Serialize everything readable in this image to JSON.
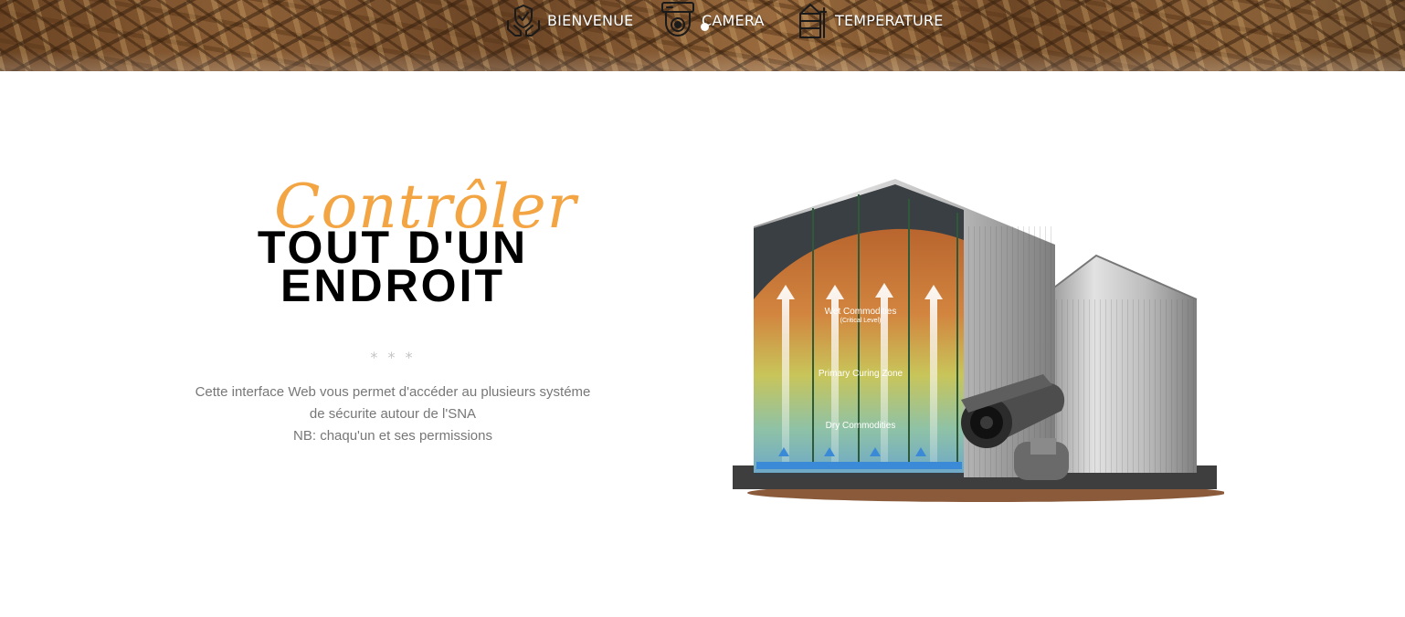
{
  "nav": {
    "items": [
      {
        "label": "BIENVENUE",
        "icon": "hands-shield-icon"
      },
      {
        "label": "CAMERA",
        "icon": "security-camera-icon"
      },
      {
        "label": "TEMPERATURE",
        "icon": "silo-icon"
      }
    ]
  },
  "hero": {
    "script_title": "Contrôler",
    "title_line1": "TOUT D'UN",
    "title_line2": "ENDROIT",
    "separator": "* * *",
    "description": [
      "Cette interface Web vous permet d'accéder au plusieurs systéme",
      "de sécurite autour de l'SNA",
      "NB: chaqu'un et ses permissions"
    ]
  },
  "illustration": {
    "labels": {
      "wet": "Wet Commodities",
      "critical": "(Critical Level)",
      "primary": "Primary Curing Zone",
      "dry": "Dry Commodities"
    }
  },
  "colors": {
    "accent": "#f3a544",
    "title": "#000000",
    "text": "#777777",
    "separator": "#c4c4c4"
  }
}
